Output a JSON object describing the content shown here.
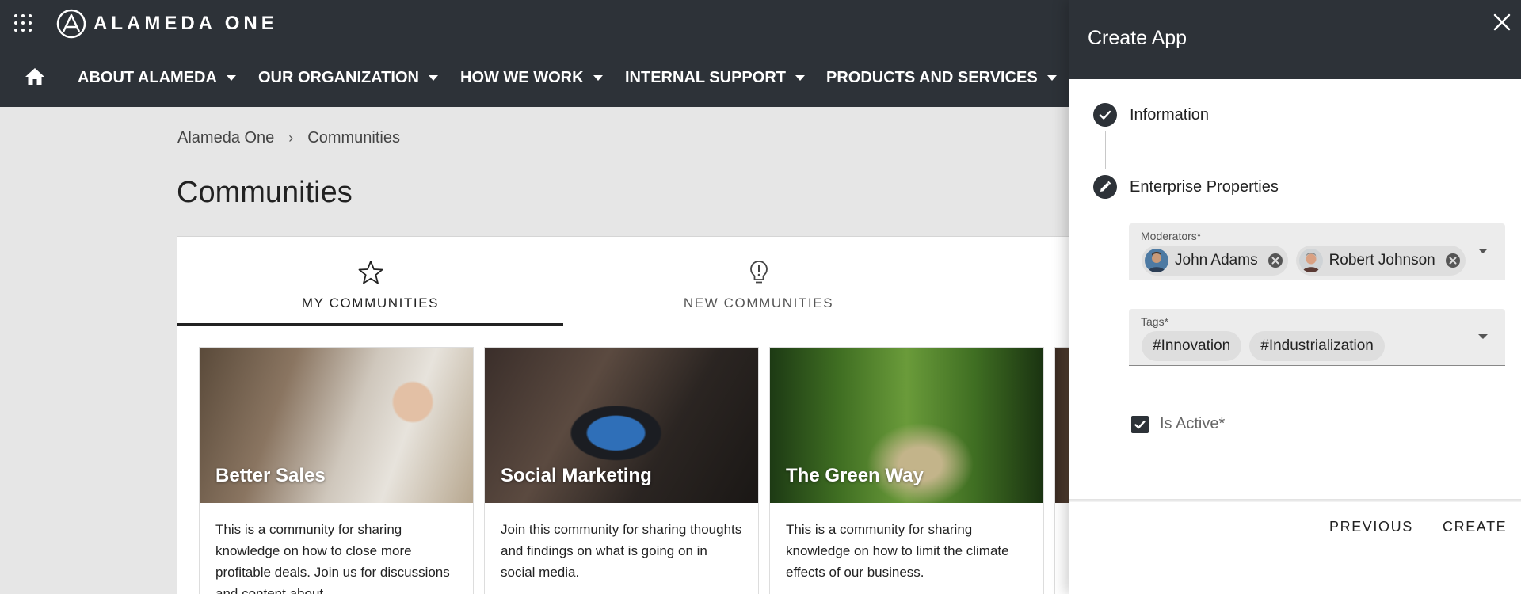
{
  "brand": {
    "name": "ALAMEDA ONE"
  },
  "nav": {
    "items": [
      {
        "label": "ABOUT ALAMEDA"
      },
      {
        "label": "OUR ORGANIZATION"
      },
      {
        "label": "HOW WE WORK"
      },
      {
        "label": "INTERNAL SUPPORT"
      },
      {
        "label": "PRODUCTS AND SERVICES"
      }
    ]
  },
  "breadcrumb": {
    "root": "Alameda One",
    "separator": "›",
    "current": "Communities"
  },
  "page": {
    "title": "Communities"
  },
  "tabs": [
    {
      "label": "MY COMMUNITIES",
      "icon": "star-icon",
      "active": true
    },
    {
      "label": "NEW COMMUNITIES",
      "icon": "lightbulb-icon",
      "active": false
    }
  ],
  "communities": [
    {
      "title": "Better Sales",
      "description": "This is a community for sharing knowledge on how to close more profitable deals. Join us for discussions and content about"
    },
    {
      "title": "Social Marketing",
      "description": "Join this community for sharing thoughts and findings on what is going on in social media."
    },
    {
      "title": "The Green Way",
      "description": "This is a community for sharing knowledge on how to limit the climate effects of our business."
    }
  ],
  "panel": {
    "title": "Create App",
    "steps": [
      {
        "label": "Information",
        "state": "completed",
        "icon": "check-icon"
      },
      {
        "label": "Enterprise Properties",
        "state": "editing",
        "icon": "pencil-icon"
      }
    ],
    "moderators": {
      "label": "Moderators*",
      "chips": [
        {
          "name": "John Adams"
        },
        {
          "name": "Robert Johnson"
        }
      ]
    },
    "tags": {
      "label": "Tags*",
      "chips": [
        {
          "name": "#Innovation"
        },
        {
          "name": "#Industrialization"
        }
      ]
    },
    "is_active": {
      "label": "Is Active*",
      "checked": true
    },
    "buttons": {
      "previous": "PREVIOUS",
      "create": "CREATE"
    }
  },
  "colors": {
    "header_bg": "#2d3238",
    "page_bg": "#e6e6e6",
    "chip_bg": "#dedede",
    "field_bg": "#ececec"
  }
}
